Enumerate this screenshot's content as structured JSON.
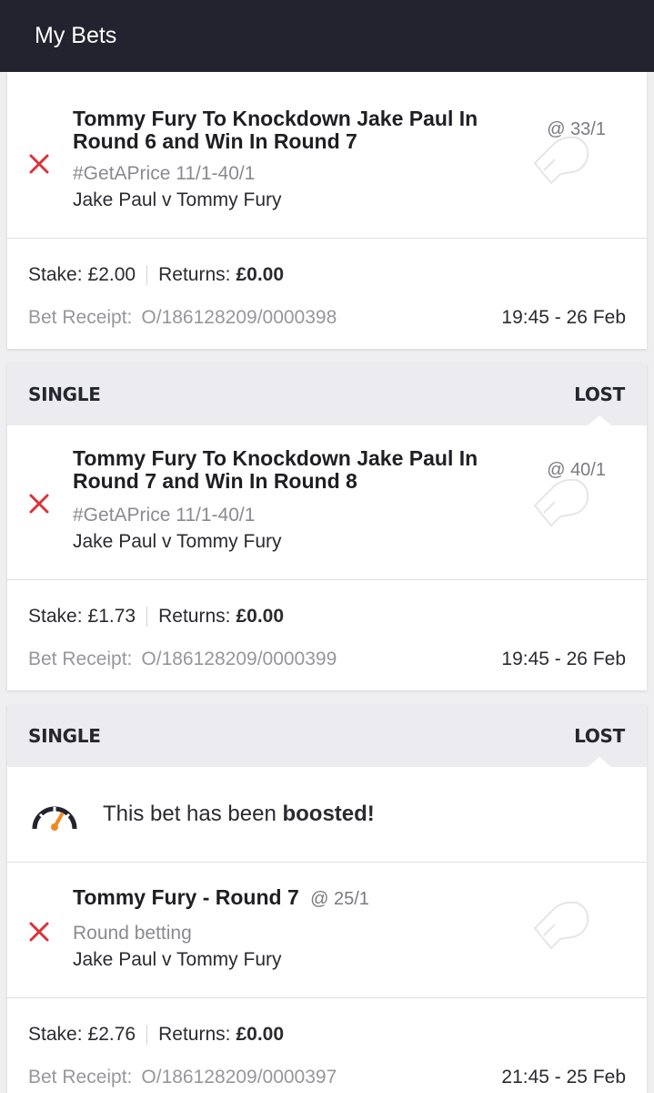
{
  "header": {
    "title": "My Bets"
  },
  "bets": [
    {
      "selection": {
        "title": "Tommy Fury To Knockdown Jake Paul In Round 6 and Win In Round 7",
        "odds": "@ 33/1",
        "market": "#GetAPrice 11/1-40/1",
        "event": "Jake Paul v Tommy Fury"
      },
      "stake_label": "Stake:",
      "stake": "£2.00",
      "returns_label": "Returns:",
      "returns": "£0.00",
      "receipt_label": "Bet Receipt:",
      "receipt": "O/186128209/0000398",
      "date": "19:45 - 26 Feb"
    },
    {
      "type": "SINGLE",
      "status": "LOST",
      "selection": {
        "title": "Tommy Fury To Knockdown Jake Paul In Round 7 and Win In Round 8",
        "odds": "@ 40/1",
        "market": "#GetAPrice 11/1-40/1",
        "event": "Jake Paul v Tommy Fury"
      },
      "stake_label": "Stake:",
      "stake": "£1.73",
      "returns_label": "Returns:",
      "returns": "£0.00",
      "receipt_label": "Bet Receipt:",
      "receipt": "O/186128209/0000399",
      "date": "19:45 - 26 Feb"
    },
    {
      "type": "SINGLE",
      "status": "LOST",
      "boost_prefix": "This bet has been",
      "boost_word": "boosted!",
      "selection": {
        "title": "Tommy Fury - Round 7",
        "odds": "@ 25/1",
        "market": "Round betting",
        "event": "Jake Paul v Tommy Fury"
      },
      "stake_label": "Stake:",
      "stake": "£2.76",
      "returns_label": "Returns:",
      "returns": "£0.00",
      "receipt_label": "Bet Receipt:",
      "receipt": "O/186128209/0000397",
      "date": "21:45 - 25 Feb"
    }
  ],
  "colors": {
    "header_bg": "#23232f",
    "lost_x": "#d9343b",
    "boost_accent": "#f2891f"
  },
  "icons": {
    "result": "lost-x-icon",
    "sport": "boxing-glove-icon",
    "boost": "speedometer-icon"
  }
}
